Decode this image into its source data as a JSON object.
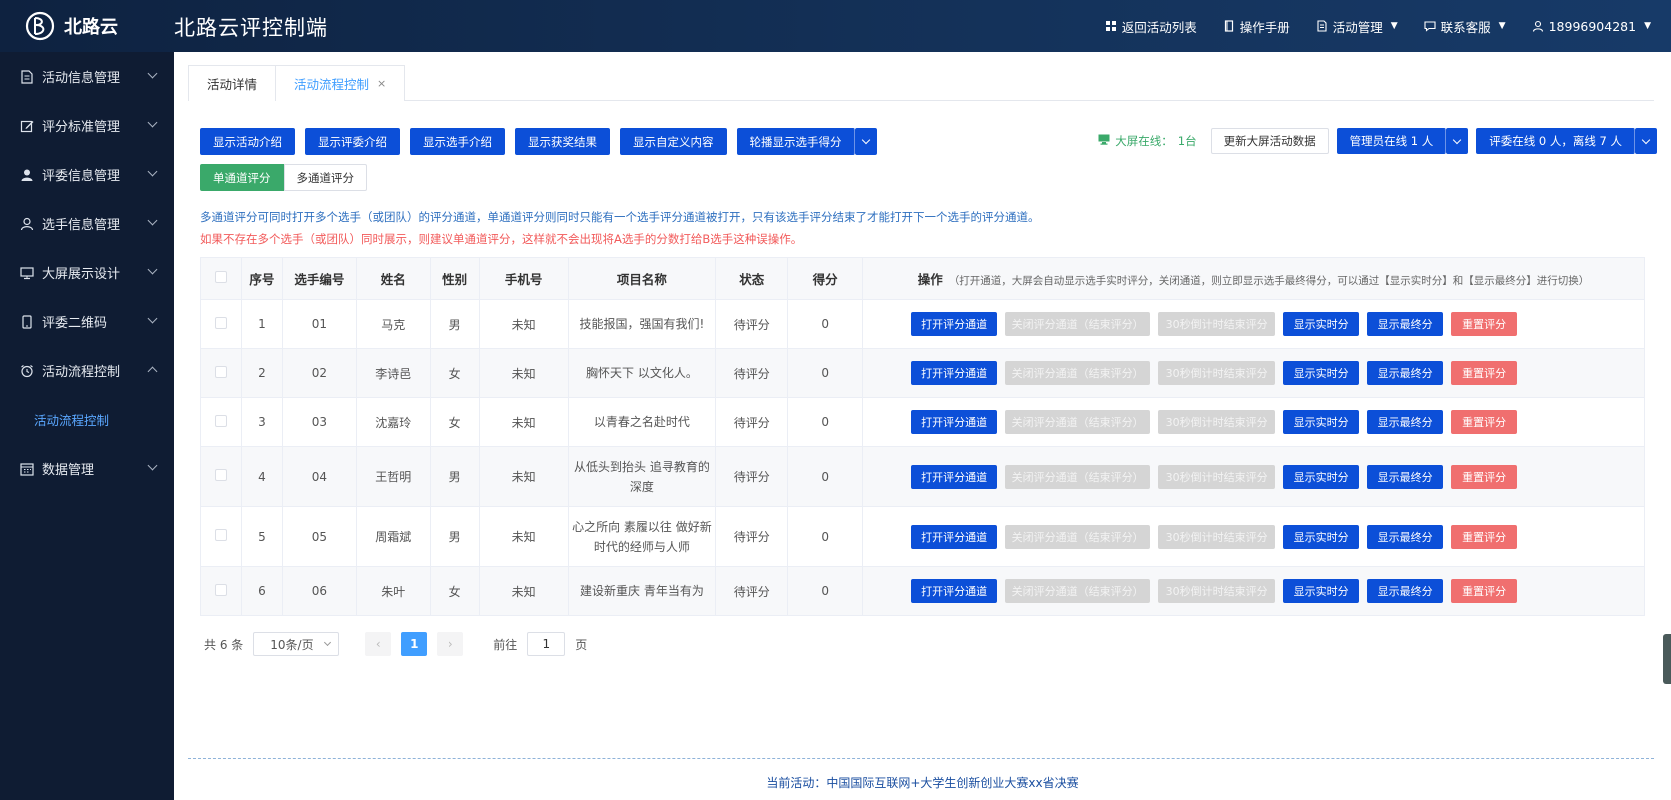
{
  "header": {
    "logo_text": "北路云",
    "app_title": "北路云评控制端",
    "nav": {
      "back": "返回活动列表",
      "manual": "操作手册",
      "activity_mgmt": "活动管理",
      "contact": "联系客服",
      "user": "18996904281"
    }
  },
  "sidebar": {
    "items": [
      {
        "label": "活动信息管理",
        "icon": "document-icon"
      },
      {
        "label": "评分标准管理",
        "icon": "edit-icon"
      },
      {
        "label": "评委信息管理",
        "icon": "person-filled-icon"
      },
      {
        "label": "选手信息管理",
        "icon": "person-icon"
      },
      {
        "label": "大屏展示设计",
        "icon": "monitor-icon"
      },
      {
        "label": "评委二维码",
        "icon": "phone-icon"
      },
      {
        "label": "活动流程控制",
        "icon": "alarm-icon"
      },
      {
        "label": "数据管理",
        "icon": "calendar-icon"
      }
    ],
    "sub_item": "活动流程控制"
  },
  "tabs": [
    {
      "label": "活动详情",
      "active": false
    },
    {
      "label": "活动流程控制",
      "active": true,
      "close": "×"
    }
  ],
  "toolbar": {
    "show_activity_intro": "显示活动介绍",
    "show_judge_intro": "显示评委介绍",
    "show_player_intro": "显示选手介绍",
    "show_award_result": "显示获奖结果",
    "show_custom": "显示自定义内容",
    "rotate_scores": "轮播显示选手得分"
  },
  "right_tools": {
    "online_label": "大屏在线：",
    "online_value": "1台",
    "update_data": "更新大屏活动数据",
    "admin_online": "管理员在线 1 人",
    "judge_online": "评委在线 0 人，离线 7 人"
  },
  "mode": {
    "single": "单通道评分",
    "multi": "多通道评分"
  },
  "notices": {
    "info": "多通道评分可同时打开多个选手（或团队）的评分通道，单通道评分则同时只能有一个选手评分通道被打开，只有该选手评分结束了才能打开下一个选手的评分通道。",
    "warn": "如果不存在多个选手（或团队）同时展示，则建议单通道评分，这样就不会出现将A选手的分数打给B选手这种误操作。"
  },
  "table": {
    "headers": {
      "index": "序号",
      "code": "选手编号",
      "name": "姓名",
      "gender": "性别",
      "phone": "手机号",
      "project": "项目名称",
      "status": "状态",
      "score": "得分",
      "ops": "操作",
      "ops_hint": "（打开通道，大屏会自动显示选手实时评分，关闭通道，则立即显示选手最终得分，可以通过【显示实时分】和【显示最终分】进行切换）"
    },
    "op_labels": {
      "open": "打开评分通道",
      "close": "关闭评分通道（结束评分）",
      "countdown": "30秒倒计时结束评分",
      "realtime": "显示实时分",
      "final": "显示最终分",
      "reset": "重置评分"
    },
    "rows": [
      {
        "index": "1",
        "code": "01",
        "name": "马克",
        "gender": "男",
        "phone": "未知",
        "project": "技能报国，强国有我们!",
        "status": "待评分",
        "score": "0"
      },
      {
        "index": "2",
        "code": "02",
        "name": "李诗邑",
        "gender": "女",
        "phone": "未知",
        "project": "胸怀天下 以文化人。",
        "status": "待评分",
        "score": "0"
      },
      {
        "index": "3",
        "code": "03",
        "name": "沈嘉玲",
        "gender": "女",
        "phone": "未知",
        "project": "以青春之名赴时代",
        "status": "待评分",
        "score": "0"
      },
      {
        "index": "4",
        "code": "04",
        "name": "王哲明",
        "gender": "男",
        "phone": "未知",
        "project": "从低头到抬头 追寻教育的深度",
        "status": "待评分",
        "score": "0"
      },
      {
        "index": "5",
        "code": "05",
        "name": "周霜斌",
        "gender": "男",
        "phone": "未知",
        "project": "心之所向 素履以往 做好新时代的经师与人师",
        "status": "待评分",
        "score": "0"
      },
      {
        "index": "6",
        "code": "06",
        "name": "朱叶",
        "gender": "女",
        "phone": "未知",
        "project": "建设新重庆 青年当有为",
        "status": "待评分",
        "score": "0"
      }
    ]
  },
  "pager": {
    "total": "共 6 条",
    "page_size": "10条/页",
    "prev": "‹",
    "current": "1",
    "next": "›",
    "goto_label": "前往",
    "goto_value": "1",
    "page_suffix": "页"
  },
  "footer": {
    "current_activity": "当前活动：中国国际互联网+大学生创新创业大赛xx省决赛"
  }
}
